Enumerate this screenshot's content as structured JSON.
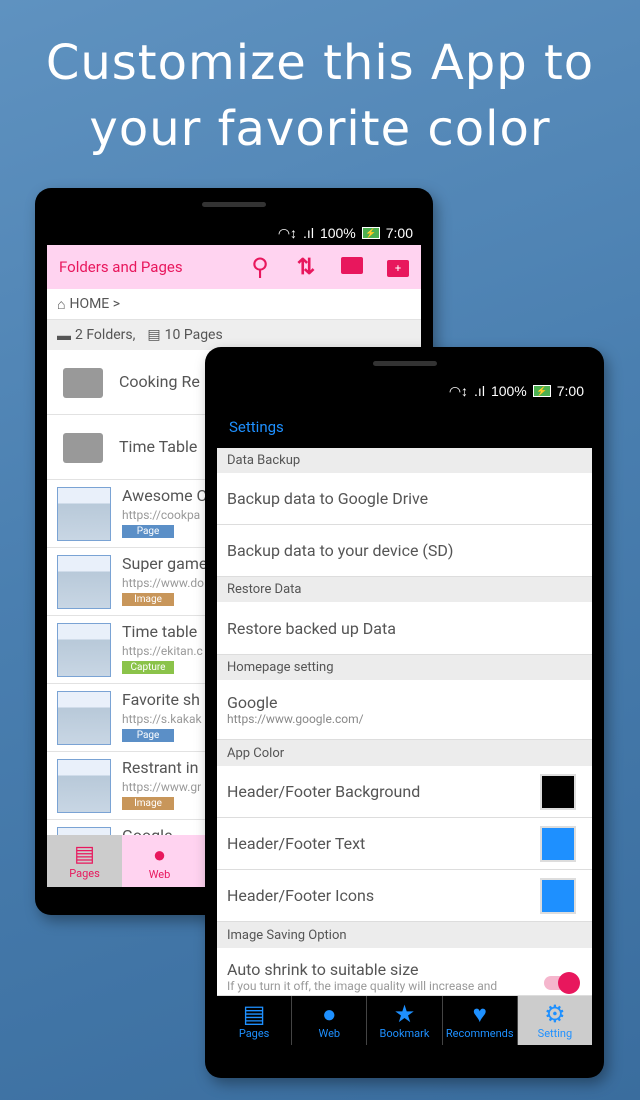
{
  "headline": {
    "line1": "Customize this App to",
    "line2": "your favorite color"
  },
  "status": {
    "battery": "100%",
    "time": "7:00"
  },
  "phone1": {
    "header": {
      "title": "Folders and Pages",
      "icons": [
        "search-icon",
        "sort-icon",
        "folder-list-icon",
        "folder-add-icon"
      ],
      "bg": "#ffd3f0",
      "fg": "#e8175d"
    },
    "breadcrumb": "HOME >",
    "counts": {
      "folders": "2 Folders,",
      "pages": "10 Pages"
    },
    "folders": [
      {
        "name": "Cooking Re"
      },
      {
        "name": "Time Table"
      }
    ],
    "pages": [
      {
        "title": "Awesome C",
        "url": "https://cookpa",
        "tag": "Page",
        "tag_color": "#5b8fc7"
      },
      {
        "title": "Super game",
        "url": "https://www.do",
        "tag": "Image",
        "tag_color": "#c8965a"
      },
      {
        "title": "Time table",
        "url": "https://ekitan.c",
        "tag": "Capture",
        "tag_color": "#8bc34a"
      },
      {
        "title": "Favorite sh",
        "url": "https://s.kakak",
        "tag": "Page",
        "tag_color": "#5b8fc7"
      },
      {
        "title": "Restrant in",
        "url": "https://www.gr",
        "tag": "Image",
        "tag_color": "#c8965a"
      },
      {
        "title": "Google",
        "url": "",
        "tag": "",
        "tag_color": ""
      }
    ],
    "nav": [
      {
        "label": "Pages",
        "icon": "pages-icon"
      },
      {
        "label": "Web",
        "icon": "globe-icon"
      }
    ]
  },
  "phone2": {
    "header": {
      "title": "Settings",
      "fg": "#1e90ff"
    },
    "sections": {
      "data_backup": "Data Backup",
      "backup_google": "Backup data to Google Drive",
      "backup_device": "Backup data to your device (SD)",
      "restore": "Restore Data",
      "restore_item": "Restore backed up Data",
      "homepage": "Homepage setting",
      "homepage_title": "Google",
      "homepage_url": "https://www.google.com/",
      "app_color": "App Color",
      "hf_bg": "Header/Footer Background",
      "hf_text": "Header/Footer Text",
      "hf_icons": "Header/Footer Icons",
      "image_saving": "Image Saving Option",
      "auto_shrink": "Auto shrink to suitable size",
      "auto_shrink_desc": "If you turn it off, the image quality will increase and"
    },
    "colors": {
      "hf_bg": "#000000",
      "hf_text": "#1e90ff",
      "hf_icons": "#1e90ff"
    },
    "auto_shrink_on": true,
    "nav": [
      {
        "label": "Pages",
        "icon": "pages-icon"
      },
      {
        "label": "Web",
        "icon": "globe-icon"
      },
      {
        "label": "Bookmark",
        "icon": "star-icon"
      },
      {
        "label": "Recommends",
        "icon": "heart-icon"
      },
      {
        "label": "Setting",
        "icon": "gear-icon",
        "active": true
      }
    ]
  }
}
